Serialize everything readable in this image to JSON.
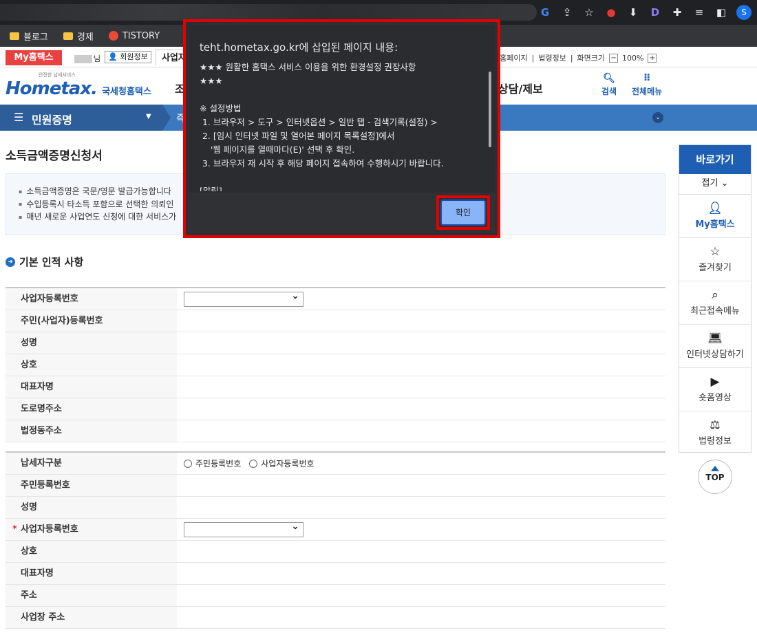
{
  "browser": {
    "bookmarks": [
      "블로그",
      "경제",
      "TISTORY"
    ]
  },
  "utilbar": {
    "my_hometax": "My홈택스",
    "user_suffix": "님",
    "member_info": "회원정보",
    "tab_partial": "사업자",
    "right_links": [
      "정홈페이지",
      "법령정보",
      "화면크기"
    ],
    "zoom_minus": "−",
    "zoom_level": "100%",
    "zoom_plus": "+"
  },
  "header": {
    "logo_small": "안전한 납세서비스",
    "logo_main": "Hometax.",
    "logo_sub": "국세청홈택스",
    "nav_partial": "조",
    "nav_right": "상담/제보",
    "search_label": "검색",
    "menu_label": "전체메뉴"
  },
  "menubar": {
    "current": "민원증명",
    "second_partial": "즉"
  },
  "page": {
    "title": "소득금액증명신청서",
    "notices": [
      "소득금액증명은 국문/영문 발급가능합니다",
      "수입등록시 타소득 포함으로 선택한 의뢰인",
      "매년 새로운 사업연도 신청에 대한 서비스가"
    ],
    "section_title": "기본 인적 사항"
  },
  "form1": [
    {
      "label": "사업자등록번호",
      "type": "select"
    },
    {
      "label": "주민(사업자)등록번호",
      "type": "text"
    },
    {
      "label": "성명",
      "type": "text"
    },
    {
      "label": "상호",
      "type": "text"
    },
    {
      "label": "대표자명",
      "type": "text"
    },
    {
      "label": "도로명주소",
      "type": "text"
    },
    {
      "label": "법정동주소",
      "type": "text"
    }
  ],
  "form2": {
    "taxpayer_type": "납세자구분",
    "radio_resident": "주민등록번호",
    "radio_business": "사업자등록번호",
    "resident_no": "주민등록번호",
    "name": "성명",
    "business_no": "사업자등록번호",
    "required_mark": "*",
    "trade_name": "상호",
    "representative": "대표자명",
    "address": "주소",
    "business_address": "사업장 주소"
  },
  "quickmenu": {
    "title": "바로가기",
    "fold": "접기",
    "items": [
      "My홈택스",
      "즐겨찾기",
      "최근접속메뉴",
      "인터넷상담하기",
      "숏폼영상",
      "법령정보"
    ]
  },
  "top_button": "TOP",
  "dialog": {
    "title": "teht.hometax.go.kr에 삽입된 페이지 내용:",
    "lines": [
      "★★★ 원활한 홈택스 서비스 이용을 위한 환경설정 권장사항",
      "★★★",
      "",
      "※ 설정방법",
      " 1. 브라우저 > 도구 > 인터넷옵션 > 일반 탭 - 검색기록(설정) >",
      " 2. [임시 인터넷 파일 및 열어본 페이지 목록설정]에서",
      "    '웹 페이지를 열때마다(E)' 선택 후 확인.",
      " 3. 브라우저 재 시작 후 해당 페이지 접속하여 수행하시기 바랍니다.",
      "",
      "[알림]"
    ],
    "ok": "확인"
  }
}
